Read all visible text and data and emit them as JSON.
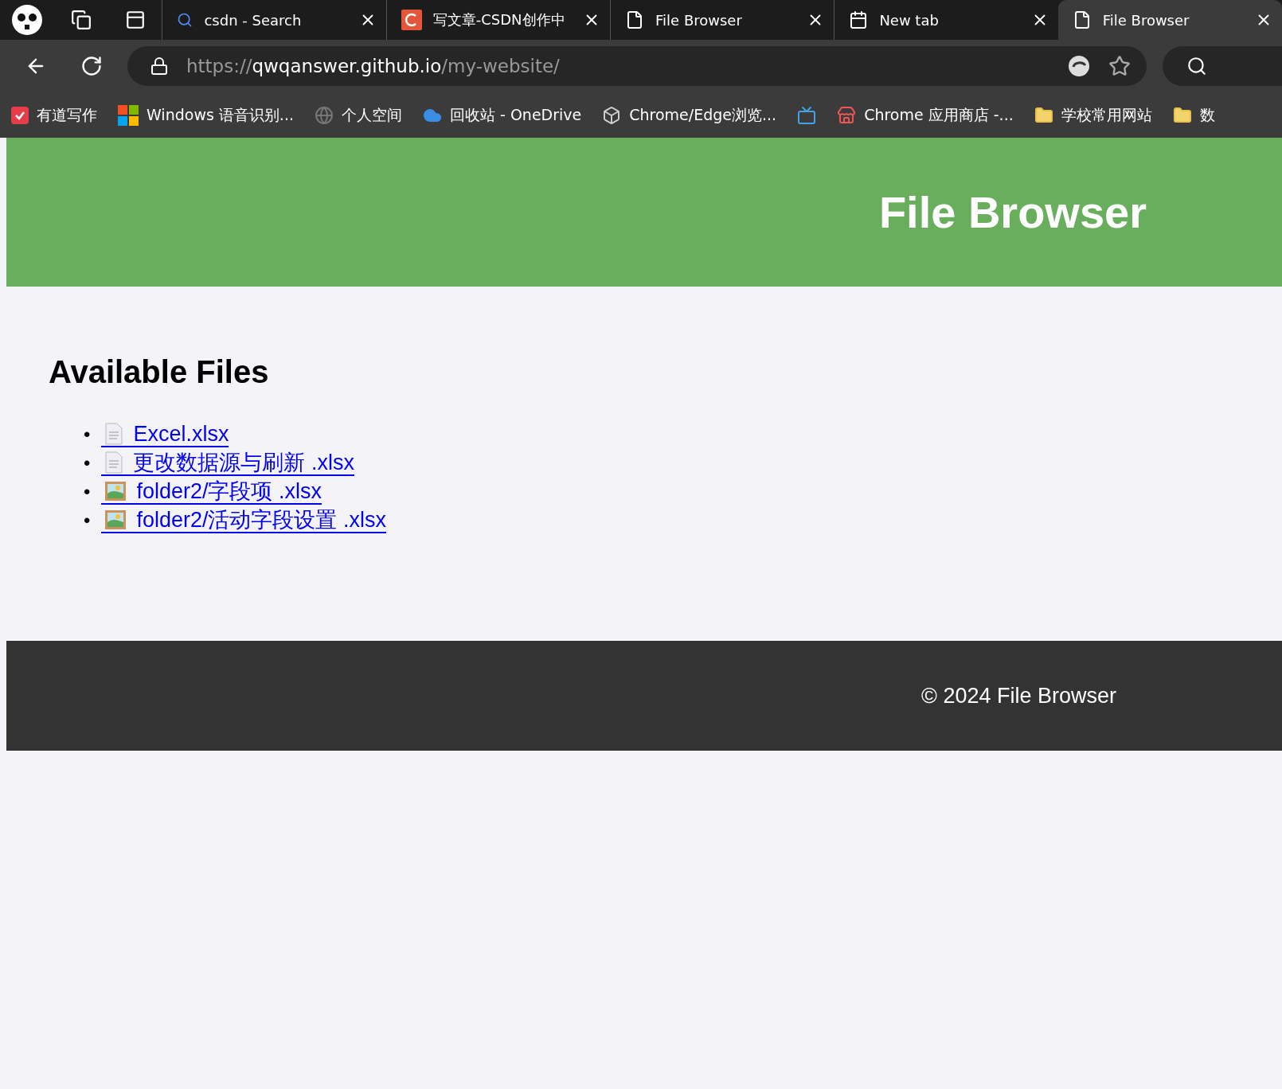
{
  "tabs": [
    {
      "kind": "search",
      "title": "csdn - Search",
      "selected": false
    },
    {
      "kind": "csdn",
      "title": "写文章-CSDN创作中",
      "selected": false
    },
    {
      "kind": "page",
      "title": "File Browser",
      "selected": false
    },
    {
      "kind": "newtab",
      "title": "New tab",
      "selected": false
    },
    {
      "kind": "page",
      "title": "File Browser",
      "selected": true
    }
  ],
  "address": {
    "scheme": "https://",
    "host": "qwqanswer.github.io",
    "path": "/my-website/"
  },
  "bookmarks": [
    {
      "kind": "youdao",
      "label": "有道写作"
    },
    {
      "kind": "windows",
      "label": "Windows 语音识别..."
    },
    {
      "kind": "globe",
      "label": "个人空间"
    },
    {
      "kind": "cloud",
      "label": "回收站 - OneDrive"
    },
    {
      "kind": "cube",
      "label": "Chrome/Edge浏览..."
    },
    {
      "kind": "tv"
    },
    {
      "kind": "store",
      "label": "Chrome 应用商店 -..."
    },
    {
      "kind": "folder",
      "label": "学校常用网站"
    },
    {
      "kind": "folder",
      "label": "数"
    }
  ],
  "header": {
    "title": "File Browser"
  },
  "section": {
    "heading": "Available Files"
  },
  "files": [
    {
      "marker": "•",
      "kind": "document",
      "name": "Excel.xlsx"
    },
    {
      "marker": "•",
      "kind": "document",
      "name": "更改数据源与刷新 .xlsx"
    },
    {
      "marker": "•",
      "kind": "image",
      "name": "folder2/字段项 .xlsx"
    },
    {
      "marker": "•",
      "kind": "image",
      "name": "folder2/活动字段设置 .xlsx"
    }
  ],
  "footer": {
    "text": "© 2024 File Browser"
  }
}
